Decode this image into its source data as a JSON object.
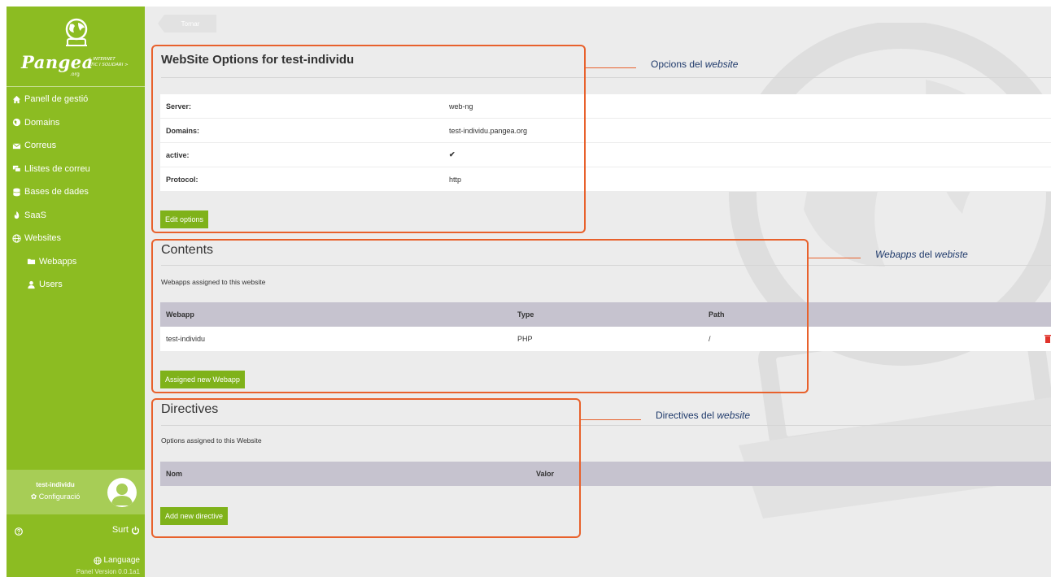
{
  "brand": {
    "name": "Pangea",
    "suffix": ".org",
    "tagline_line1": "< INTERNET",
    "tagline_line2": "ÈTIC I SOLIDARI >"
  },
  "sidebar": {
    "items": [
      {
        "label": "Panell de gestió",
        "icon": "home-icon"
      },
      {
        "label": "Domains",
        "icon": "globe-icon"
      },
      {
        "label": "Correus",
        "icon": "envelope-icon"
      },
      {
        "label": "Llistes de correu",
        "icon": "mailing-list-icon"
      },
      {
        "label": "Bases de dades",
        "icon": "database-icon"
      },
      {
        "label": "SaaS",
        "icon": "fire-icon"
      },
      {
        "label": "Websites",
        "icon": "globe-icon"
      },
      {
        "label": "Webapps",
        "icon": "folder-icon"
      },
      {
        "label": "Users",
        "icon": "user-icon"
      }
    ],
    "user": {
      "name": "test-individu",
      "config_label": "Configuració"
    },
    "logout_label": "Surt",
    "language_label": "Language",
    "version": "Panel Version 0.0.1a1"
  },
  "main": {
    "back_label": "Tornar",
    "options": {
      "title": "WebSite Options for test-individu",
      "rows": [
        {
          "key": "Server:",
          "value": "web-ng"
        },
        {
          "key": "Domains:",
          "value": "test-individu.pangea.org"
        },
        {
          "key": "active:",
          "value": "✔"
        },
        {
          "key": "Protocol:",
          "value": "http"
        }
      ],
      "edit_label": "Edit options"
    },
    "contents": {
      "title": "Contents",
      "description": "Webapps assigned to this website",
      "headers": [
        "Webapp",
        "Type",
        "Path"
      ],
      "rows": [
        {
          "webapp": "test-individu",
          "type": "PHP",
          "path": "/"
        }
      ],
      "button_label": "Assigned new Webapp"
    },
    "directives": {
      "title": "Directives",
      "description": "Options assigned to this Website",
      "headers": [
        "Nom",
        "Valor"
      ],
      "button_label": "Add new directive"
    }
  },
  "annotations": [
    {
      "prefix": "Opcions del ",
      "emph": "website",
      "suffix": ""
    },
    {
      "prefix": "",
      "emph": "Webapps",
      "suffix": " del ",
      "emph2": "webiste"
    },
    {
      "prefix": "Directives del ",
      "emph": "website",
      "suffix": ""
    }
  ],
  "colors": {
    "sidebar": "#8cbc22",
    "button": "#7fb21a",
    "annotation": "#e8612c",
    "table_header": "#c6c3cf"
  }
}
